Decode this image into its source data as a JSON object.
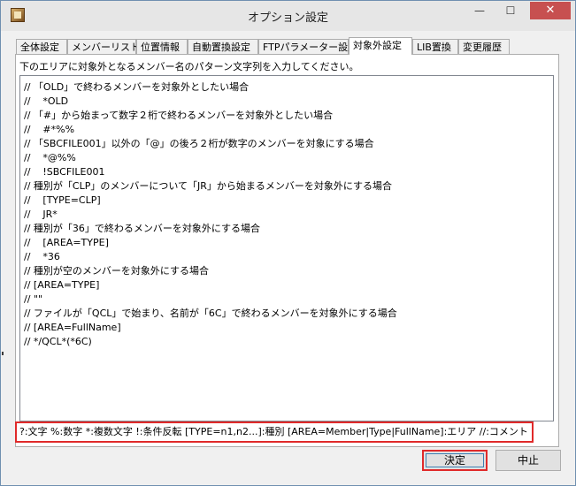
{
  "window": {
    "title": "オプション設定"
  },
  "titlebar_buttons": {
    "minimize": "—",
    "maximize": "☐",
    "close": "✕"
  },
  "tabs": [
    {
      "label": "全体設定",
      "active": false
    },
    {
      "label": "メンバーリスト",
      "active": false
    },
    {
      "label": "位置情報",
      "active": false
    },
    {
      "label": "自動置換設定",
      "active": false
    },
    {
      "label": "FTPパラメーター設定",
      "active": false
    },
    {
      "label": "対象外設定",
      "active": true
    },
    {
      "label": "LIB置換",
      "active": false
    },
    {
      "label": "変更履歴",
      "active": false
    }
  ],
  "instruction": "下のエリアに対象外となるメンバー名のパターン文字列を入力してください。",
  "editor": {
    "lines": [
      "// 「OLD」で終わるメンバーを対象外としたい場合",
      "//    *OLD",
      "// 「#」から始まって数字２桁で終わるメンバーを対象外としたい場合",
      "//    #*%%",
      "// 「SBCFILE001」以外の「@」の後ろ２桁が数字のメンバーを対象にする場合",
      "//    *@%%",
      "//    !SBCFILE001",
      "// 種別が「CLP」のメンバーについて「JR」から始まるメンバーを対象外にする場合",
      "//    [TYPE=CLP]",
      "//    JR*",
      "// 種別が「36」で終わるメンバーを対象外にする場合",
      "//    [AREA=TYPE]",
      "//    *36",
      "// 種別が空のメンバーを対象外にする場合",
      "// [AREA=TYPE]",
      "// \"\"",
      "// ファイルが「QCL」で始まり、名前が「6C」で終わるメンバーを対象外にする場合",
      "// [AREA=FullName]",
      "// */QCL*(*6C)"
    ]
  },
  "hint": "?:文字  %:数字  *:複数文字  !:条件反転  [TYPE=n1,n2...]:種別  [AREA=Member|Type|FullName]:エリア //:コメント",
  "buttons": {
    "ok": "決定",
    "cancel": "中止"
  }
}
